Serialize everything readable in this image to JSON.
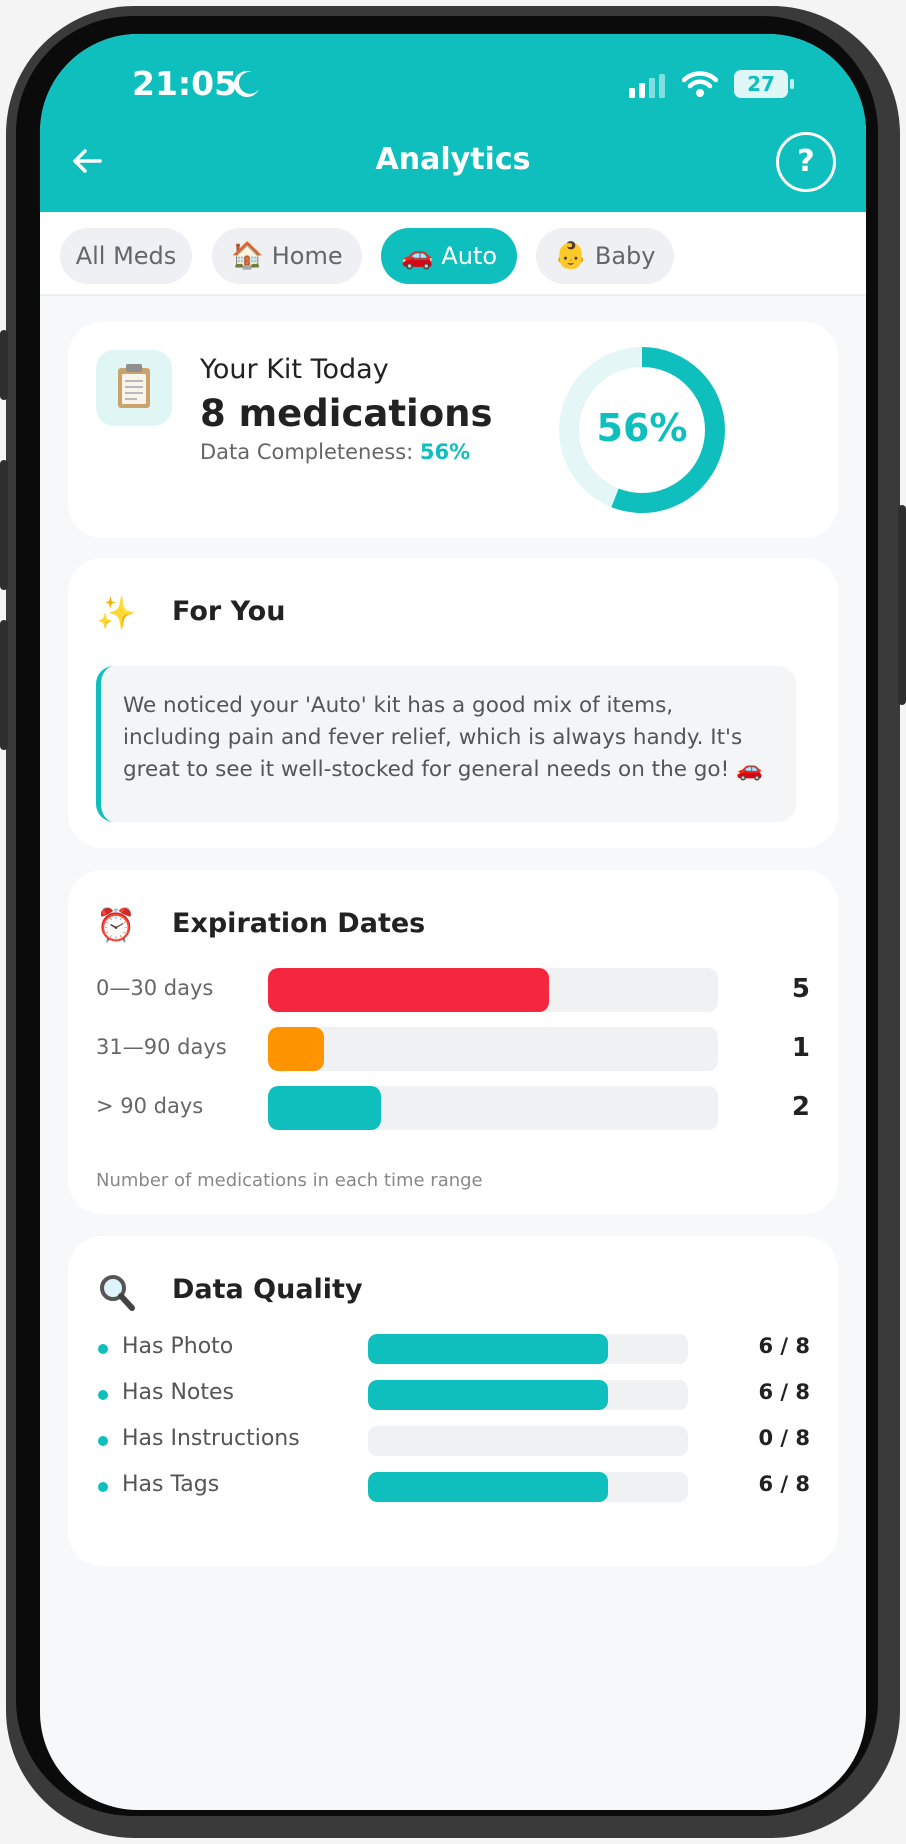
{
  "status_bar": {
    "time": "21:05",
    "battery": "27"
  },
  "header": {
    "title": "Analytics",
    "help_label": "?"
  },
  "tabs": [
    {
      "label": "All Meds",
      "emoji": "",
      "active": false
    },
    {
      "label": "Home",
      "emoji": "🏠",
      "active": false
    },
    {
      "label": "Auto",
      "emoji": "🚗",
      "active": true
    },
    {
      "label": "Baby",
      "emoji": "👶",
      "active": false
    }
  ],
  "kit": {
    "label": "Your Kit Today",
    "count": "8 medications",
    "completeness_label": "Data Completeness: ",
    "completeness_value": "56%",
    "ring_text": "56%",
    "ring_fraction": 0.56
  },
  "for_you": {
    "emoji": "✨",
    "title": "For You",
    "text": "We noticed your 'Auto' kit has a good mix of items, including pain and fever relief, which is always handy. It's great to see it well-stocked for general needs on the go! 🚗"
  },
  "expiration": {
    "emoji": "⏰",
    "title": "Expiration Dates",
    "note": "Number of medications in each time range",
    "rows": [
      {
        "label": "0—30 days",
        "value": 5,
        "fraction": 0.625,
        "color": "#f5273f"
      },
      {
        "label": "31—90 days",
        "value": 1,
        "fraction": 0.125,
        "color": "#fe9500"
      },
      {
        "label": "> 90 days",
        "value": 2,
        "fraction": 0.25,
        "color": "#0ebfbe"
      }
    ]
  },
  "data_quality": {
    "emoji": "🔍",
    "title": "Data Quality",
    "rows": [
      {
        "label": "Has Photo",
        "value": "6 / 8",
        "fraction": 0.75
      },
      {
        "label": "Has Notes",
        "value": "6 / 8",
        "fraction": 0.75
      },
      {
        "label": "Has Instructions",
        "value": "0 / 8",
        "fraction": 0
      },
      {
        "label": "Has Tags",
        "value": "6 / 8",
        "fraction": 0.75
      }
    ]
  },
  "colors": {
    "accent": "#0ebfbe",
    "danger": "#f5273f",
    "warning": "#fe9500"
  }
}
